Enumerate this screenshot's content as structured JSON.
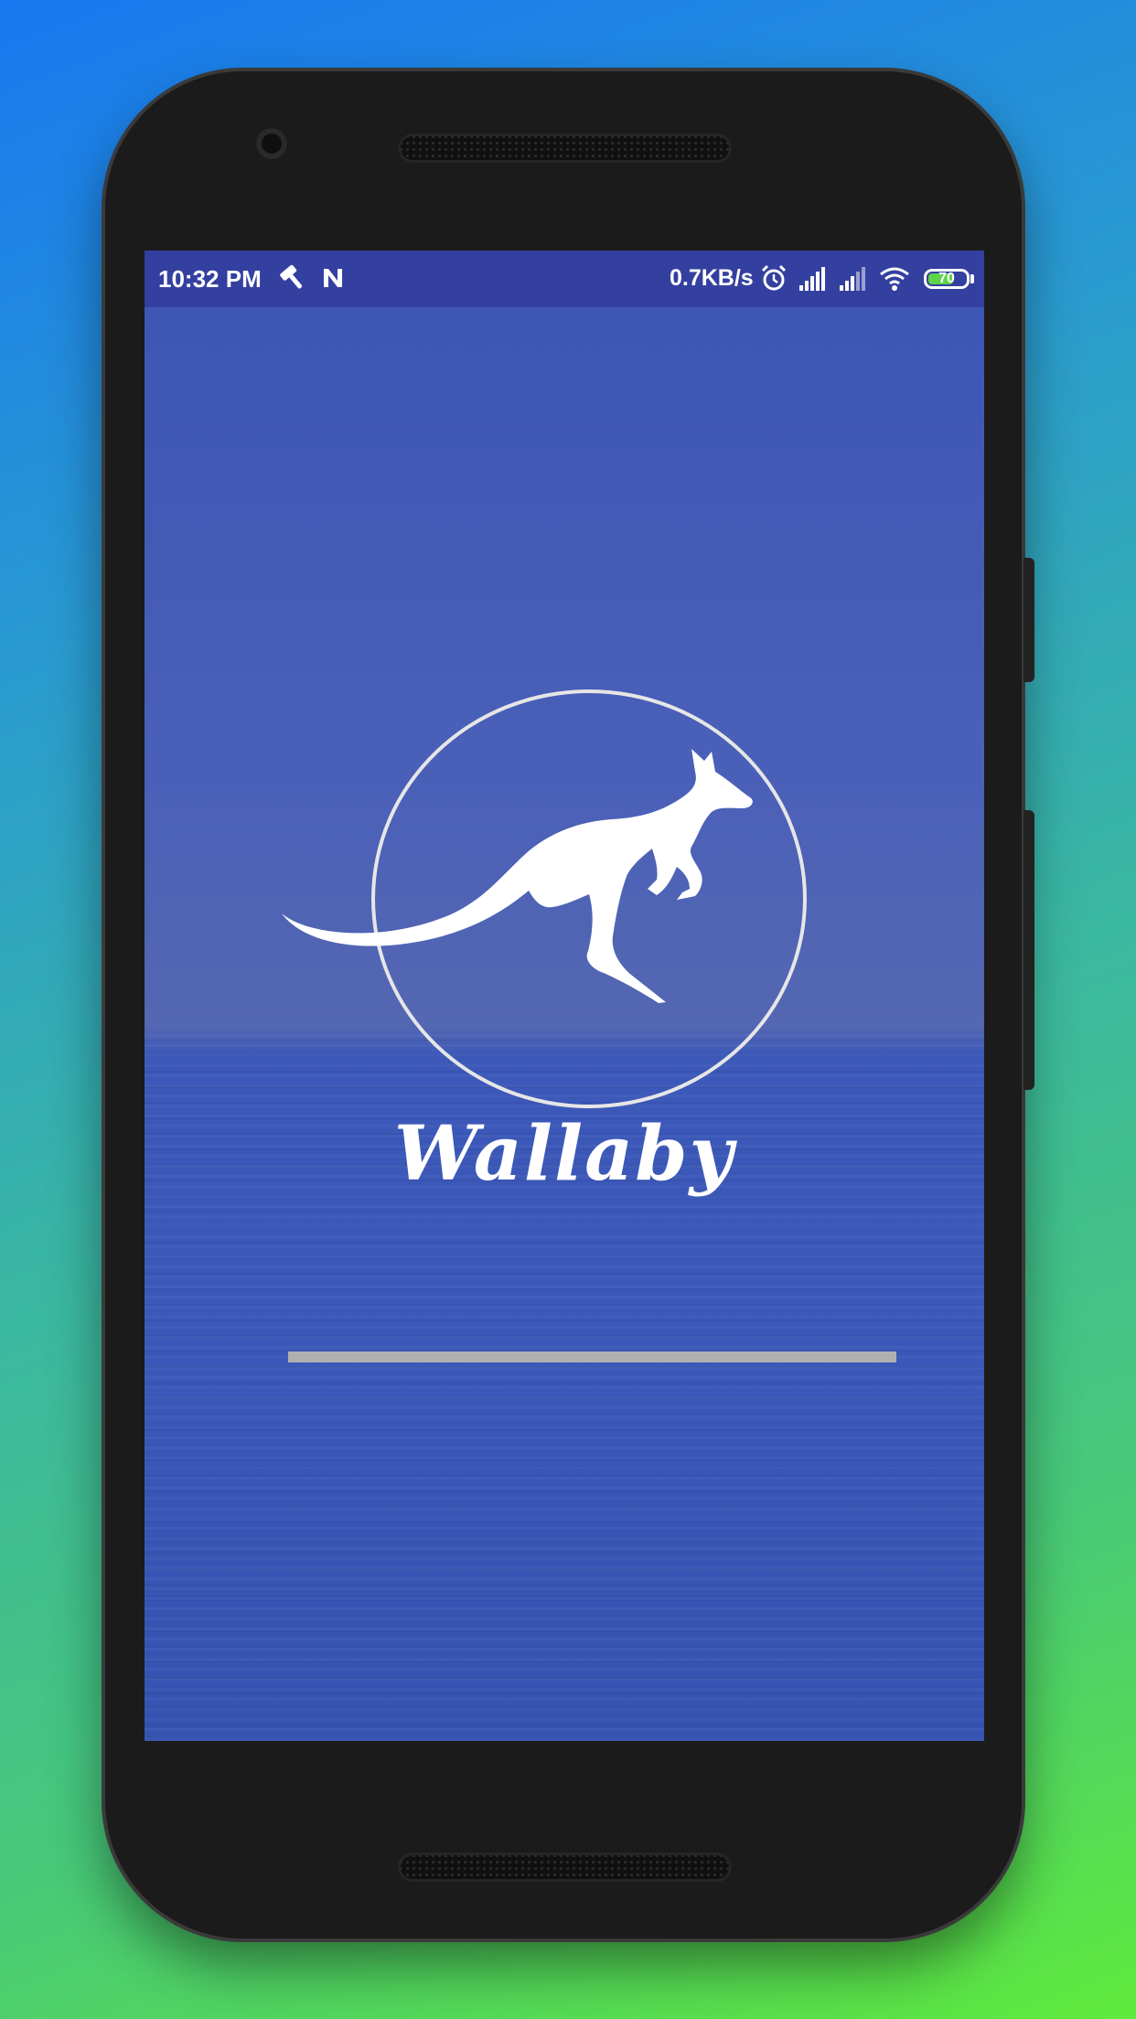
{
  "status_bar": {
    "time": "10:32 PM",
    "network_speed": "0.7KB/s",
    "battery_level": "70",
    "battery_color": "#5fd44a",
    "icons": [
      "hammer-icon",
      "n-notification-icon",
      "alarm-icon",
      "signal-icon",
      "signal-icon",
      "wifi-icon",
      "battery-icon"
    ]
  },
  "splash": {
    "app_name": "Wallaby",
    "logo_icon": "kangaroo-icon",
    "progress": 0
  },
  "colors": {
    "status_bar": "#3440a0",
    "background": "#3c55b4",
    "accent": "#ffffff"
  }
}
